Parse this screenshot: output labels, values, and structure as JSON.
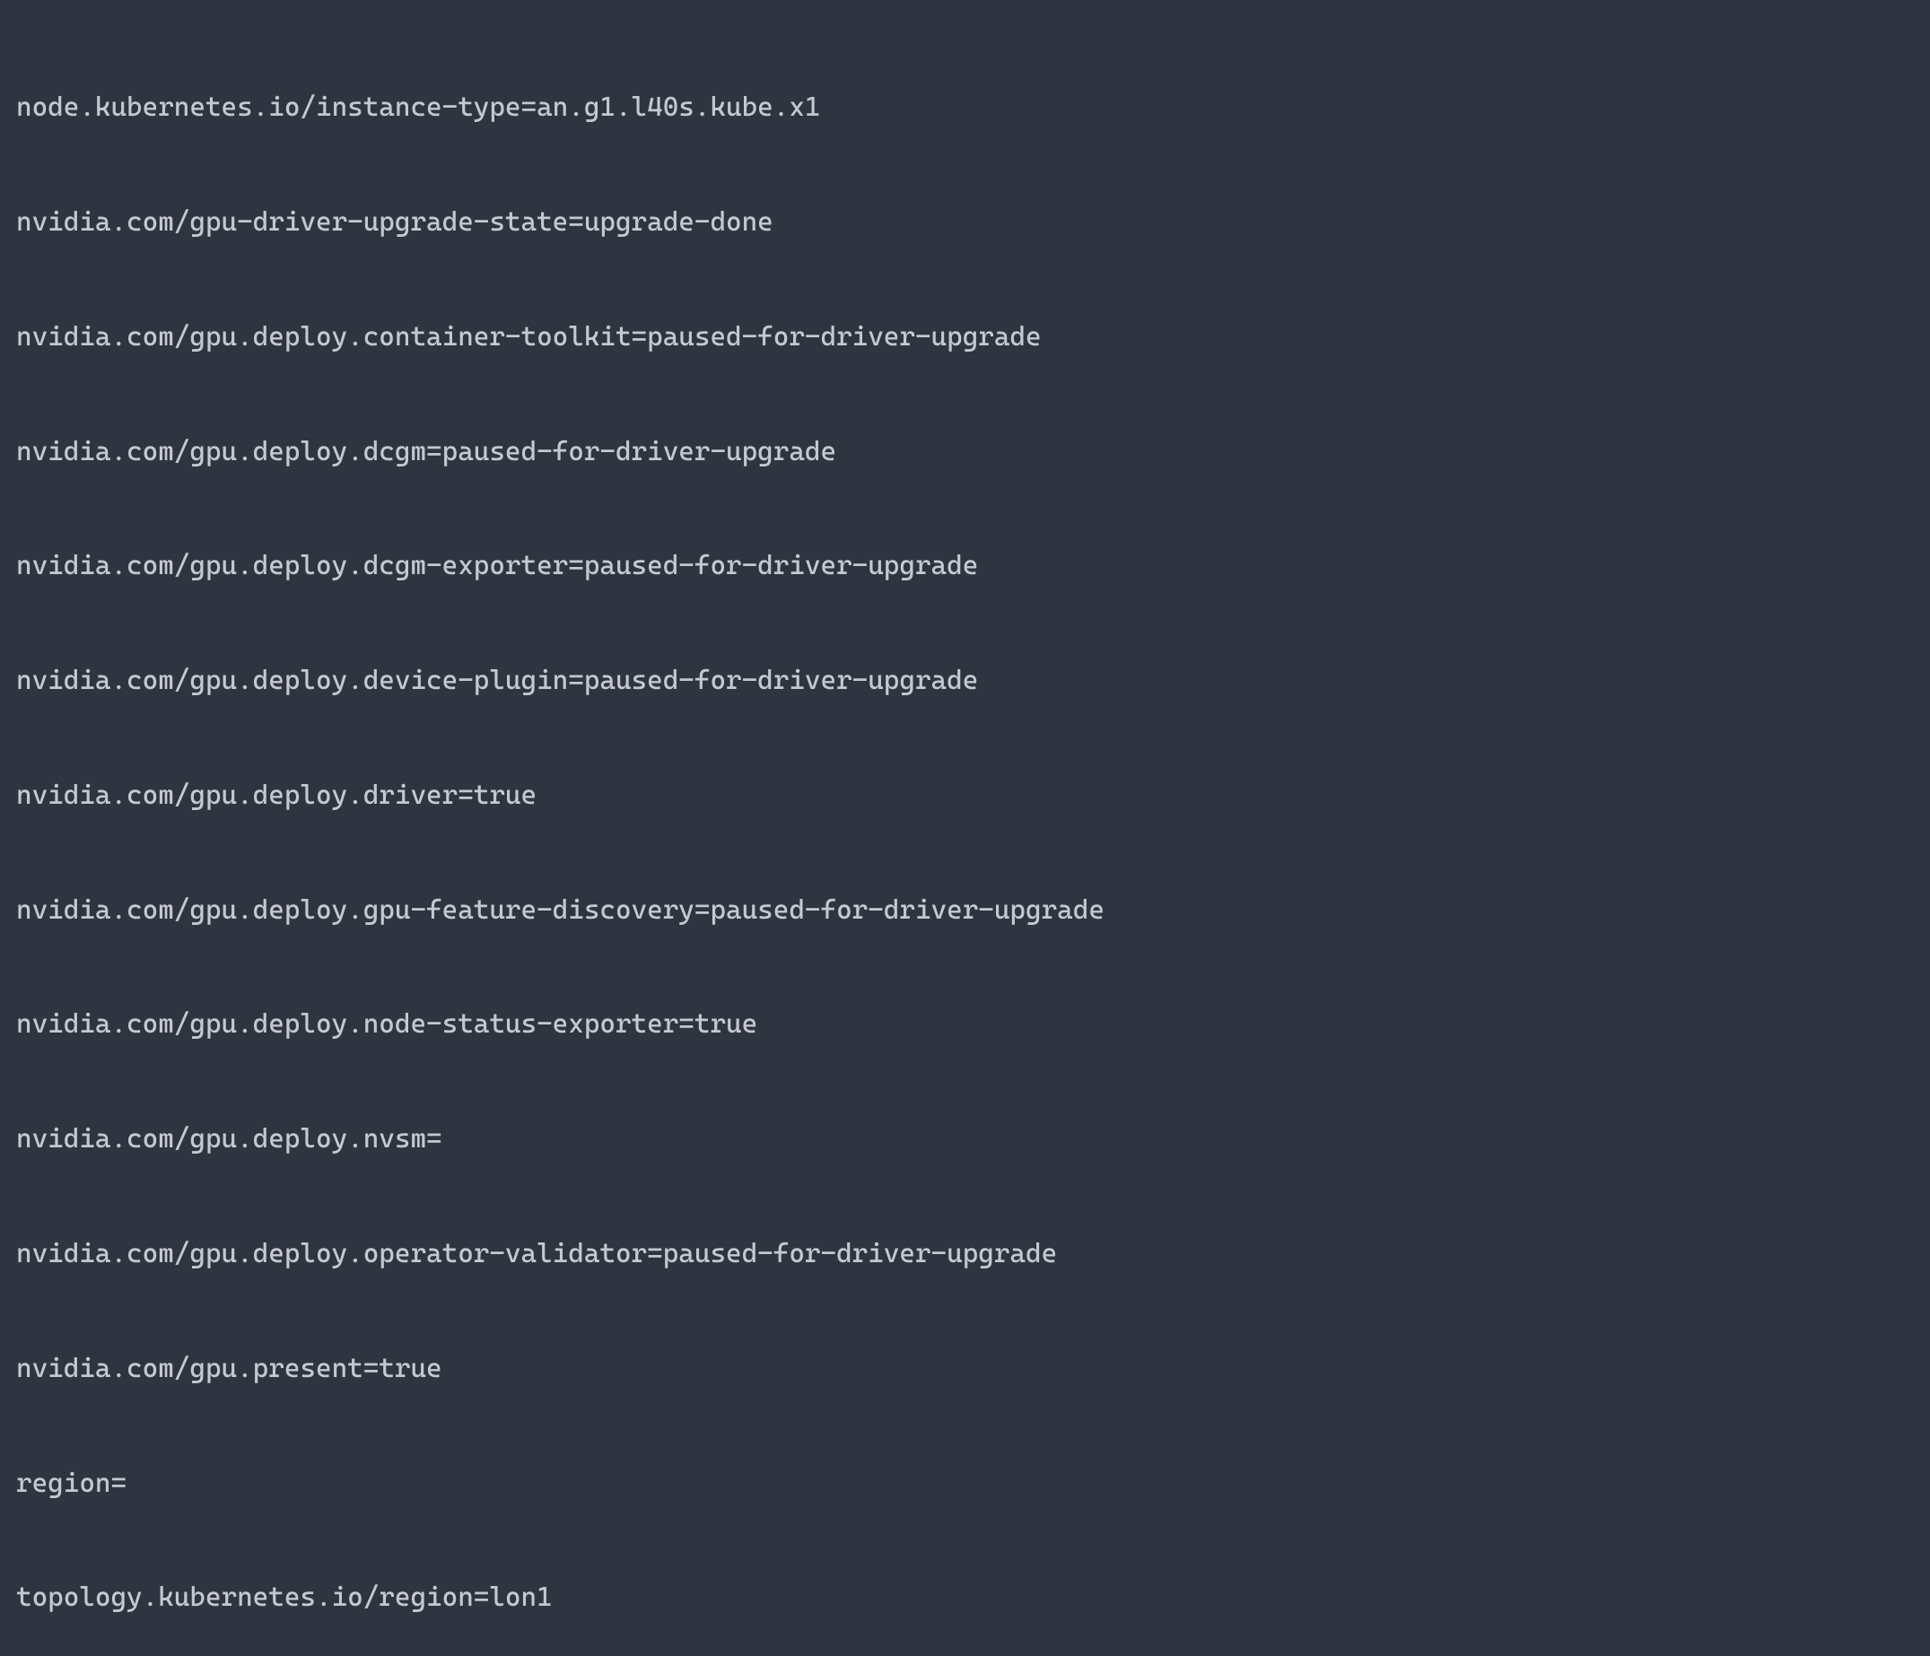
{
  "terminal": {
    "lines": [
      "node.kubernetes.io/instance-type=an.g1.l40s.kube.x1",
      "nvidia.com/gpu-driver-upgrade-state=upgrade-done",
      "nvidia.com/gpu.deploy.container-toolkit=paused-for-driver-upgrade",
      "nvidia.com/gpu.deploy.dcgm=paused-for-driver-upgrade",
      "nvidia.com/gpu.deploy.dcgm-exporter=paused-for-driver-upgrade",
      "nvidia.com/gpu.deploy.device-plugin=paused-for-driver-upgrade",
      "nvidia.com/gpu.deploy.driver=true",
      "nvidia.com/gpu.deploy.gpu-feature-discovery=paused-for-driver-upgrade",
      "nvidia.com/gpu.deploy.node-status-exporter=true",
      "nvidia.com/gpu.deploy.nvsm=",
      "nvidia.com/gpu.deploy.operator-validator=paused-for-driver-upgrade",
      "nvidia.com/gpu.present=true",
      "region=",
      "topology.kubernetes.io/region=lon1"
    ]
  }
}
